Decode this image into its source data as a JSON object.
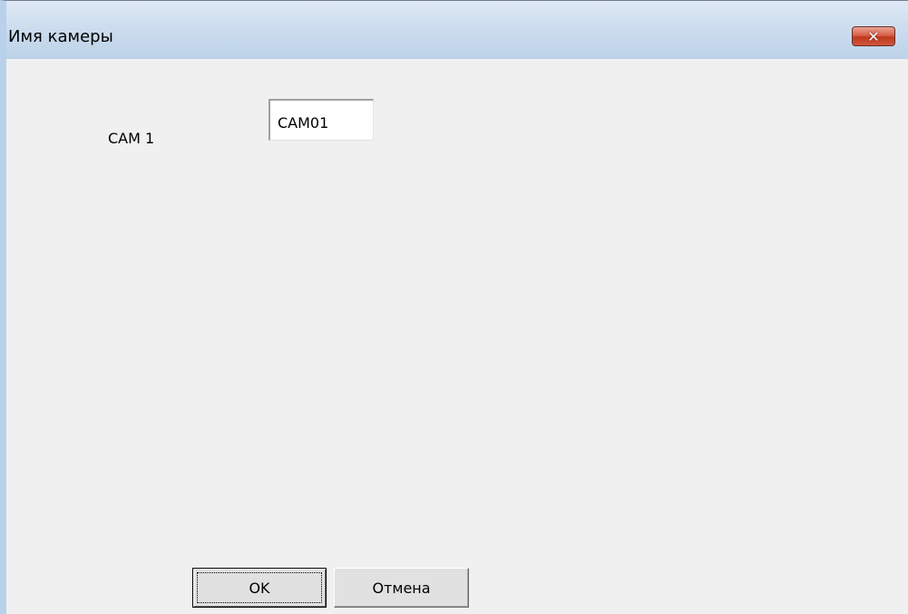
{
  "window": {
    "title": "Имя камеры",
    "close_glyph": "✕"
  },
  "form": {
    "camera_label": "CAM 1",
    "camera_name_value": "CAM01"
  },
  "buttons": {
    "ok_label": "OK",
    "cancel_label": "Отмена"
  },
  "colors": {
    "titlebar": "#cbdcee",
    "client_background": "#f0f0f0",
    "close_button": "#c7432a"
  },
  "icons": {
    "close": "close-icon"
  }
}
